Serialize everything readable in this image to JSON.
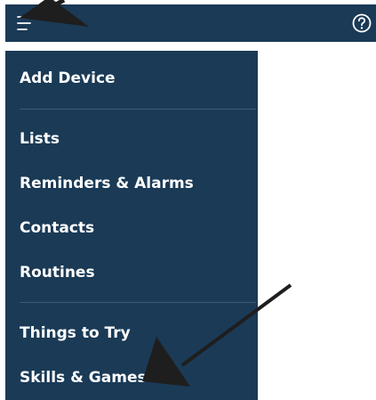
{
  "topbar": {
    "menu_icon": "hamburger-menu-icon",
    "help_icon": "help-circle-icon"
  },
  "drawer": {
    "items": [
      {
        "label": "Add Device"
      },
      {
        "label": "Lists"
      },
      {
        "label": "Reminders & Alarms"
      },
      {
        "label": "Contacts"
      },
      {
        "label": "Routines"
      },
      {
        "label": "Things to Try"
      },
      {
        "label": "Skills & Games"
      }
    ]
  },
  "colors": {
    "nav_background": "#1a3a56",
    "divider": "#3c5b75",
    "text": "#ffffff",
    "annotation_arrow": "#1e1e1e"
  }
}
